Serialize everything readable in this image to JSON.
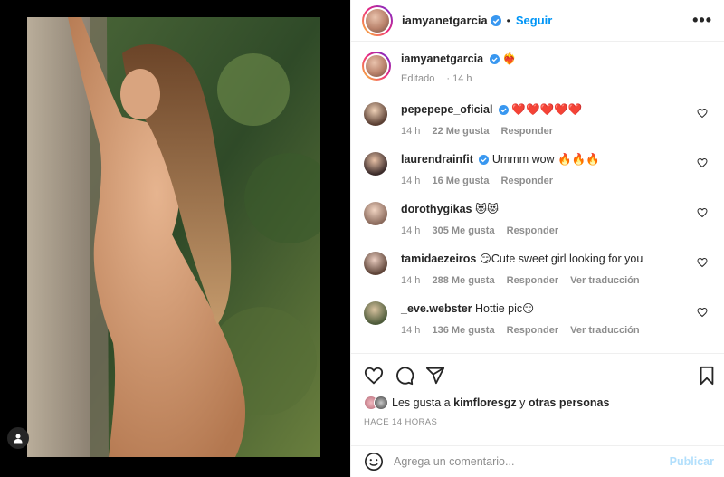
{
  "post": {
    "username": "iamyanetgarcia",
    "follow_label": "Seguir",
    "more_label": "•••",
    "caption_text": "❤️‍🔥",
    "edited_label": "Editado",
    "edited_time": "14 h"
  },
  "comments": [
    {
      "user": "pepepepe_oficial",
      "verified": true,
      "text": "❤️❤️❤️❤️❤️",
      "time": "14 h",
      "likes": "22 Me gusta",
      "reply": "Responder",
      "translate": ""
    },
    {
      "user": "laurendrainfit",
      "verified": true,
      "text": "Ummm wow 🔥🔥🔥",
      "time": "14 h",
      "likes": "16 Me gusta",
      "reply": "Responder",
      "translate": ""
    },
    {
      "user": "dorothygikas",
      "verified": false,
      "text": "😻😻",
      "time": "14 h",
      "likes": "305 Me gusta",
      "reply": "Responder",
      "translate": ""
    },
    {
      "user": "tamidaezeiros",
      "verified": false,
      "text": "😏Cute sweet girl looking for you",
      "time": "14 h",
      "likes": "288 Me gusta",
      "reply": "Responder",
      "translate": "Ver traducción"
    },
    {
      "user": "_eve.webster",
      "verified": false,
      "text": "Hottie pic😏",
      "time": "14 h",
      "likes": "136 Me gusta",
      "reply": "Responder",
      "translate": "Ver traducción"
    }
  ],
  "likes": {
    "prefix": "Les gusta a",
    "user": "kimfloresgz",
    "conj": "y",
    "others": "otras personas"
  },
  "timestamp": "HACE 14 HORAS",
  "comment_box": {
    "placeholder": "Agrega un comentario...",
    "publish": "Publicar"
  },
  "colors": {
    "accent": "#0095f6",
    "verified": "#3897f0",
    "muted": "#8e8e8e"
  },
  "icons": [
    "heart-icon",
    "comment-icon",
    "share-icon",
    "bookmark-icon",
    "emoji-icon",
    "more-icon",
    "verified-icon",
    "user-tag-icon"
  ]
}
